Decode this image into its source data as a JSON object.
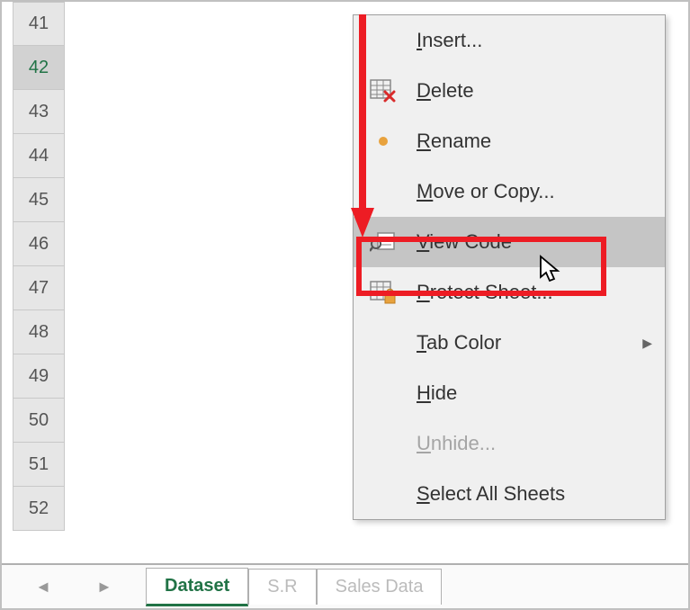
{
  "rows": [
    "41",
    "42",
    "43",
    "44",
    "45",
    "46",
    "47",
    "48",
    "49",
    "50",
    "51",
    "52"
  ],
  "selected_row": "42",
  "tabs": {
    "active": "Dataset",
    "tab2": "S.R",
    "tab3": "Sales Data"
  },
  "menu": {
    "insert": "Insert...",
    "delete": "Delete",
    "rename": "Rename",
    "move_copy": "Move or Copy...",
    "view_code": "View Code",
    "protect_sheet": "Protect Sheet...",
    "tab_color": "Tab Color",
    "hide": "Hide",
    "unhide": "Unhide...",
    "select_all": "Select All Sheets"
  }
}
